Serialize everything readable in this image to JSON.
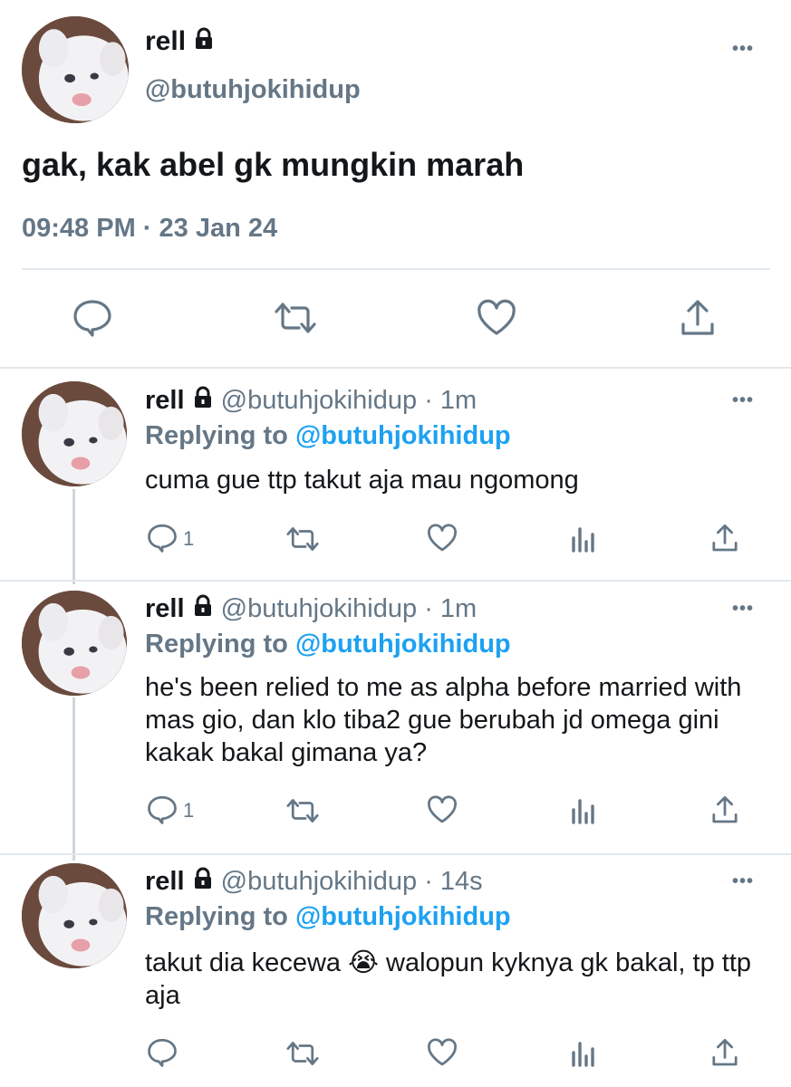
{
  "main_tweet": {
    "display_name": "rell",
    "handle": "@butuhjokihidup",
    "more_label": "•••",
    "text": "gak, kak abel gk mungkin marah",
    "timestamp": "09:48 PM · 23 Jan 24"
  },
  "main_actions": {
    "icons": [
      "reply-icon",
      "retweet-icon",
      "like-icon",
      "share-icon"
    ]
  },
  "replies": [
    {
      "display_name": "rell",
      "meta": "@butuhjokihidup · 1m",
      "replying_prefix": "Replying to",
      "replying_mention": "@butuhjokihidup",
      "text": "cuma gue ttp takut aja mau ngomong",
      "reply_count": "1",
      "more_label": "•••"
    },
    {
      "display_name": "rell",
      "meta": "@butuhjokihidup · 1m",
      "replying_prefix": "Replying to",
      "replying_mention": "@butuhjokihidup",
      "text": "he's been relied to me as alpha before married with mas gio, dan klo tiba2 gue berubah jd omega gini kakak bakal gimana ya?",
      "reply_count": "1",
      "more_label": "•••"
    },
    {
      "display_name": "rell",
      "meta": "@butuhjokihidup · 14s",
      "replying_prefix": "Replying to",
      "replying_mention": "@butuhjokihidup",
      "text": "takut dia kecewa 😭 walopun kyknya gk bakal, tp ttp aja",
      "reply_count": "",
      "more_label": "•••"
    }
  ],
  "colors": {
    "text": "#14171a",
    "secondary": "#657786",
    "accent": "#1da1f2",
    "divider": "#e1e8ed"
  }
}
